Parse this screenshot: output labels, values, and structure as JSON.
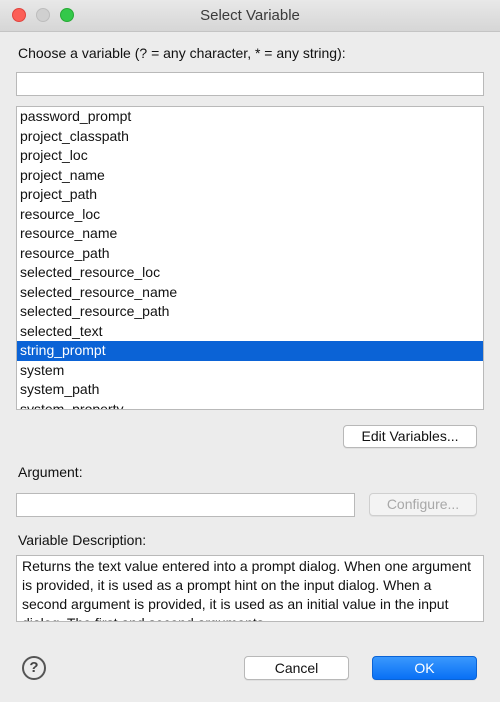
{
  "window": {
    "title": "Select Variable"
  },
  "filter": {
    "label": "Choose a variable (? = any character, * = any string):",
    "value": ""
  },
  "variables": {
    "items": [
      "password_prompt",
      "project_classpath",
      "project_loc",
      "project_name",
      "project_path",
      "resource_loc",
      "resource_name",
      "resource_path",
      "selected_resource_loc",
      "selected_resource_name",
      "selected_resource_path",
      "selected_text",
      "string_prompt",
      "system",
      "system_path",
      "system_property"
    ],
    "selected": "string_prompt"
  },
  "buttons": {
    "edit_variables": "Edit Variables...",
    "configure": "Configure...",
    "cancel": "Cancel",
    "ok": "OK",
    "help": "?"
  },
  "argument": {
    "label": "Argument:",
    "value": ""
  },
  "description": {
    "label": "Variable Description:",
    "text": "Returns the text value entered into a prompt dialog. When one argument is provided, it is used as a prompt hint on the input dialog. When a second argument is provided, it is used as an initial value in the input dialog. The first and second arguments"
  },
  "colors": {
    "selection": "#0b63d6",
    "primary_button": "#1a7ff7"
  }
}
